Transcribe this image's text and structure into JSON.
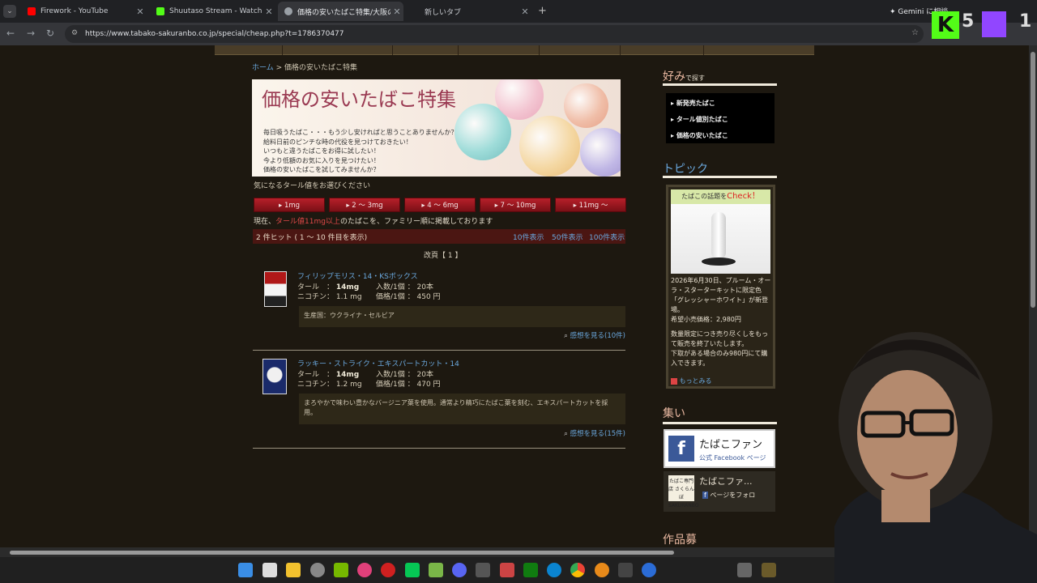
{
  "browser": {
    "tabs": [
      {
        "title": "Firework - YouTube",
        "fav_color": "#ff0000"
      },
      {
        "title": "Shuutaso Stream - Watch Live on",
        "fav_color": "#53fc18"
      },
      {
        "title": "価格の安いたばこ特集/大阪のたば",
        "fav_color": "#9aa0a6"
      },
      {
        "title": "新しいタブ",
        "fav_color": ""
      }
    ],
    "url": "https://www.tabako-sakuranbo.co.jp/special/cheap.php?t=1786370477",
    "gemini_label": "Gemini に相談"
  },
  "overlay": {
    "kick_count": "5",
    "twitch_count": "1",
    "kick_letter": "K"
  },
  "page": {
    "breadcrumb": {
      "home": "ホーム",
      "sep": " > ",
      "current": "価格の安いたばこ特集"
    },
    "banner": {
      "title": "価格の安いたばこ特集",
      "lines": [
        "毎日吸うたばこ・・・もう少し安ければと思うことありませんか？",
        "給料日前のピンチな時の代役を見つけておきたい！",
        "いつもと違うたばこをお得に試したい！",
        "今より低額のお気に入りを見つけたい！",
        "価格の安いたばこを試してみませんか？"
      ]
    },
    "prompt": "気になるタール値をお選びください",
    "tar_buttons": [
      "1mg",
      "2 ～ 3mg",
      "4 ～ 6mg",
      "7 ～ 10mg",
      "11mg ～"
    ],
    "note": {
      "prefix": "現在、",
      "highlight": "タール値11mg以上",
      "suffix": "のたばこを、ファミリー順に掲載しております"
    },
    "hits": {
      "count_text": "2 件ヒット ( 1 ～ 10 件目を表示)",
      "links": [
        "10件表示",
        "50件表示",
        "100件表示"
      ]
    },
    "pager": "改頁【 1 】",
    "products": [
      {
        "name": "フィリップモリス・14・KSボックス",
        "tar_label": "タール　：",
        "tar": "14mg",
        "nic_label": "ニコチン：",
        "nic": "1.1 mg",
        "qty_label": "入数/1個 ：",
        "qty": "20本",
        "price_label": "価格/1個 ：",
        "price": "450 円",
        "desc": "生産国：ウクライナ・セルビア",
        "review": "感想を見る(10件)",
        "pack_color": "#b01818"
      },
      {
        "name": "ラッキー・ストライク・エキスパートカット・14",
        "tar_label": "タール　：",
        "tar": "14mg",
        "nic_label": "ニコチン：",
        "nic": "1.2 mg",
        "qty_label": "入数/1個 ：",
        "qty": "20本",
        "price_label": "価格/1個 ：",
        "price": "470 円",
        "desc": "まろやかで味わい豊かなバージニア葉を使用。通常より精巧にたばこ葉を刻む、エキスパートカットを採用。",
        "review": "感想を見る(15件)",
        "pack_color": "#1a2a6a"
      }
    ]
  },
  "sidebar": {
    "pref_head": "好み",
    "pref_sub": "で探す",
    "menu": [
      "新発売たばこ",
      "タール値別たばこ",
      "価格の安いたばこ"
    ],
    "topic_head": "トピック",
    "topic_banner_pre": "たばこの話題を",
    "topic_banner_check": "Check",
    "topic_banner_post": "！",
    "topic_lines": [
      "2026年6月30日、プルーム・オーラ・スターターキットに限定色「グレッシャーホワイト」が新登場。",
      "希望小売価格：2,980円",
      "数量限定につき売り尽くしをもって販売を終了いたします。",
      "下取がある場合のみ980円にて購入できます。"
    ],
    "topic_more": "もっとみる",
    "gather_head": "集い",
    "fb_icon": "f",
    "fb_title": "たばこファン",
    "fb_sub": "公式 Facebook ページ",
    "fbw_name": "たばこファ...",
    "fbw_like": "ページをフォロ",
    "fbw_logo": "たばこ専門店 さくらんぼ SAKURANBO",
    "works_head": "作品募"
  }
}
